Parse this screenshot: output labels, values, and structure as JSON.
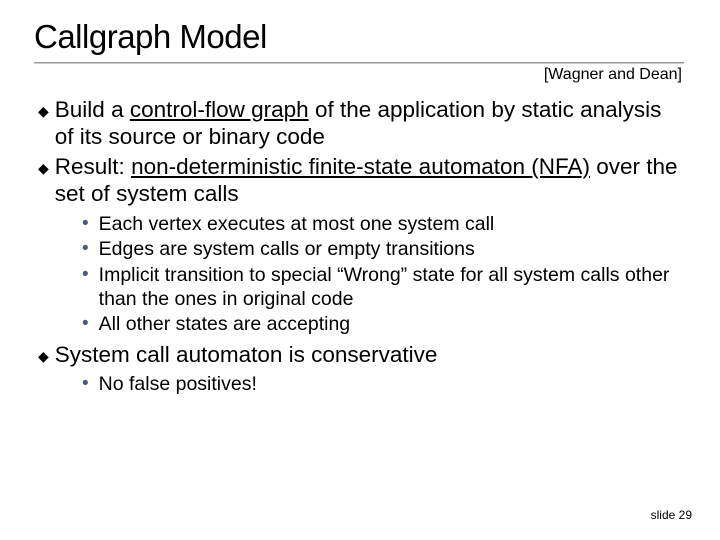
{
  "title": "Callgraph Model",
  "citation": "[Wagner and Dean]",
  "bullets": [
    {
      "pre": "Build a ",
      "u": "control-flow graph",
      "post": " of the application by static analysis of its source or binary code"
    },
    {
      "pre": "Result: ",
      "u": "non-deterministic finite-state automaton (NFA)",
      "post": " over the set of system calls"
    }
  ],
  "sub1": [
    "Each vertex executes at most one system call",
    "Edges are system calls or empty transitions",
    "Implicit transition to special “Wrong” state for all system calls other than the ones in original code",
    "All other states are accepting"
  ],
  "bullet3": "System call automaton is conservative",
  "sub2": [
    "No false positives!"
  ],
  "footer": "slide 29",
  "diamond": "◆",
  "dot": "•"
}
